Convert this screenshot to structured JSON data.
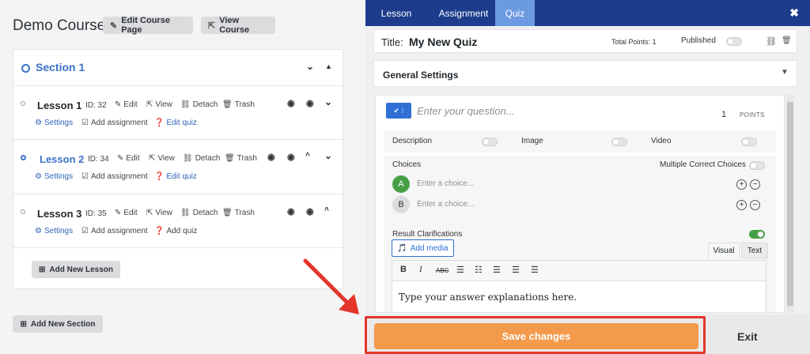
{
  "left": {
    "course_title": "Demo Course",
    "edit_course_page": "Edit Course Page",
    "view_course": "View Course",
    "section": {
      "title": "Section 1"
    },
    "lessons": [
      {
        "title": "Lesson 1",
        "id": "ID: 32",
        "edit": "Edit",
        "view": "View",
        "detach": "Detach",
        "trash": "Trash",
        "settings": "Settings",
        "add_assignment": "Add assignment",
        "quiz": "Edit quiz"
      },
      {
        "title": "Lesson 2",
        "id": "ID: 34",
        "edit": "Edit",
        "view": "View",
        "detach": "Detach",
        "trash": "Trash",
        "settings": "Settings",
        "add_assignment": "Add assignment",
        "quiz": "Edit quiz"
      },
      {
        "title": "Lesson 3",
        "id": "ID: 35",
        "edit": "Edit",
        "view": "View",
        "detach": "Detach",
        "trash": "Trash",
        "settings": "Settings",
        "add_assignment": "Add assignment",
        "quiz": "Add quiz"
      }
    ],
    "add_new_lesson": "Add New Lesson",
    "add_new_section": "Add New Section"
  },
  "right": {
    "tabs": [
      "Lesson",
      "Assignment",
      "Quiz"
    ],
    "active_tab": "Quiz",
    "close": "✖",
    "title_label": "Title:",
    "title_value": "My New Quiz",
    "total_points": "Total Points: 1",
    "published": "Published",
    "general_settings": "General Settings",
    "question_placeholder": "Enter your question...",
    "points_value": "1",
    "points_label": "POINTS",
    "options": {
      "description": "Description",
      "image": "Image",
      "video": "Video"
    },
    "choices_label": "Choices",
    "multiple_correct": "Multiple Correct Choices",
    "choices": [
      {
        "letter": "A",
        "placeholder": "Enter a choice..."
      },
      {
        "letter": "B",
        "placeholder": "Enter a choice..."
      }
    ],
    "result_clarifications": "Result Clarifications",
    "add_media": "Add media",
    "visual_tab": "Visual",
    "text_tab": "Text",
    "editor_text": "Type your answer explanations here.",
    "save_changes": "Save changes",
    "exit": "Exit"
  },
  "colors": {
    "tabbar": "#1e3c8c",
    "active_tab": "#6b9ae0",
    "save": "#f39a4c",
    "highlight": "#e5352b",
    "link": "#3b73c9"
  }
}
